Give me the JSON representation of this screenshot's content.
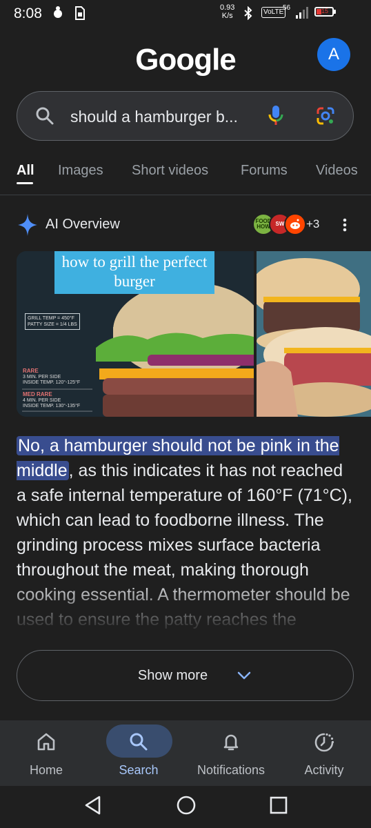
{
  "status_bar": {
    "time": "8:08",
    "speed_value": "0.93",
    "speed_unit": "K/s",
    "volte": "VoLTE",
    "network": "56",
    "battery_level": "15",
    "battery_color": "#e53935"
  },
  "header": {
    "logo": "Google",
    "avatar_letter": "A"
  },
  "search": {
    "query": "should a hamburger b...",
    "icons": [
      "search-icon",
      "mic-icon",
      "google-lens-icon"
    ]
  },
  "tabs": [
    {
      "label": "All",
      "active": true
    },
    {
      "label": "Images"
    },
    {
      "label": "Short videos"
    },
    {
      "label": "Forums"
    },
    {
      "label": "Videos"
    }
  ],
  "ai_overview": {
    "title": "AI Overview",
    "source_badges": [
      "FOOD HOW",
      "SW",
      "reddit"
    ],
    "more_sources": "+3",
    "images": {
      "caption": "how to grill the perfect burger",
      "grill_temp": "GRILL TEMP = 450°F",
      "patty_size": "PATTY SIZE = 1/4 LBS",
      "rare_title": "RARE",
      "rare_line1": "3 MIN. PER SIDE",
      "rare_line2": "INSIDE TEMP. 120°-125°F",
      "medrare_title": "MED RARE",
      "medrare_line1": "4 MIN. PER SIDE",
      "medrare_line2": "INSIDE TEMP. 130°-135°F"
    },
    "highlight": "No, a hamburger should not be pink in the middle",
    "body": ", as this indicates it has not reached a safe internal temperature of 160°F (71°C), which can lead to foodborne illness. The grinding process mixes surface bacteria throughout the meat, making thorough cooking essential. A thermometer should be used to ensure the patty reaches the",
    "highlight_color": "#394d8f",
    "show_more": "Show more"
  },
  "bottom_nav": [
    {
      "label": "Home",
      "icon": "home-icon"
    },
    {
      "label": "Search",
      "icon": "search-icon",
      "active": true
    },
    {
      "label": "Notifications",
      "icon": "bell-icon"
    },
    {
      "label": "Activity",
      "icon": "activity-icon"
    }
  ],
  "system_nav": [
    "back-icon",
    "home-circle-icon",
    "recents-icon"
  ]
}
